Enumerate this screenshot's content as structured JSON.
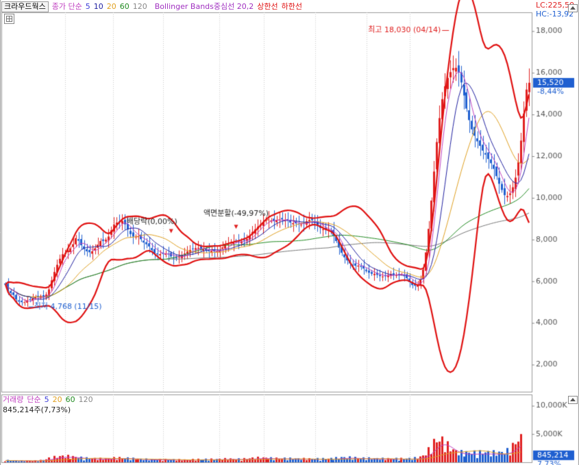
{
  "header": {
    "stock_name": "크라우드웍스",
    "ma_label": "종가 단순",
    "ma_periods": [
      {
        "text": "5",
        "color": "#3a3ad8"
      },
      {
        "text": "10",
        "color": "#1f1fa0"
      },
      {
        "text": "20",
        "color": "#e0a020"
      },
      {
        "text": "60",
        "color": "#1f8a1f"
      },
      {
        "text": "120",
        "color": "#888888"
      }
    ],
    "bb_label": "Bollinger Bands중심선 20,2",
    "bb_upper": "상한선",
    "bb_lower": "하한선",
    "lc": "LC:225,50",
    "hc": "HC:-13,92"
  },
  "volume_header": {
    "label": "거래량",
    "ma_label": "단순",
    "ma_periods": [
      {
        "text": "5",
        "color": "#3a3ad8"
      },
      {
        "text": "20",
        "color": "#e0a020"
      },
      {
        "text": "60",
        "color": "#1f8a1f"
      },
      {
        "text": "120",
        "color": "#888888"
      }
    ],
    "current": "845,214주(7,73%)"
  },
  "colors": {
    "up": "#e02020",
    "down": "#1f5fd0",
    "bb": "#e01010",
    "ma5": "#c040c0",
    "ma10": "#1f1fa0",
    "ma20": "#e0a020",
    "ma60": "#1f8a1f",
    "ma120": "#777777",
    "axis": "#888888"
  },
  "chart_data": {
    "type": "candlestick",
    "price_axis": {
      "ticks": [
        2000,
        4000,
        6000,
        8000,
        10000,
        12000,
        14000,
        16000,
        18000
      ],
      "tick_labels": [
        "2,000",
        "4,000",
        "6,000",
        "8,000",
        "10,000",
        "12,000",
        "14,000",
        "16,000",
        "18,000"
      ],
      "ylim": [
        700,
        18900
      ]
    },
    "volume_axis": {
      "ticks": [
        5000,
        10000
      ],
      "tick_labels": [
        "5,000K",
        "10,000K"
      ],
      "ylim": [
        0,
        12000
      ]
    },
    "last_price": "15,520",
    "last_change": "-8,44%",
    "last_volume": "845,214",
    "last_volume_pct": "7,73%",
    "annotations": {
      "high": {
        "text": "최고 18,030 (04/14)",
        "index": 164,
        "value": 18030
      },
      "low": {
        "text": "최저 4,768 (11/15)",
        "index": 8,
        "value": 4768
      },
      "dividend": {
        "text": "배당락(0,00%)",
        "index": 54,
        "value": 8900
      },
      "split": {
        "text": "액면분할(-49,97%)",
        "index": 85,
        "value": 9100
      }
    },
    "close": [
      5836,
      5590,
      5434,
      5339,
      5130,
      5023,
      4997,
      4994,
      5089,
      5114,
      5173,
      5267,
      5245,
      5294,
      5212,
      5358,
      5607,
      6042,
      6444,
      6789,
      7077,
      7295,
      7359,
      7468,
      7579,
      7777,
      8073,
      7945,
      7726,
      7548,
      7437,
      7392,
      7441,
      7580,
      7756,
      7931,
      7934,
      7995,
      8142,
      8444,
      8714,
      8813,
      8852,
      8892,
      8732,
      8486,
      8262,
      8142,
      8149,
      8158,
      8015,
      7857,
      7775,
      7669,
      7491,
      7338,
      7292,
      7301,
      7316,
      7338,
      7294,
      7193,
      7111,
      7111,
      7174,
      7236,
      7331,
      7426,
      7498,
      7566,
      7586,
      7602,
      7544,
      7537,
      7475,
      7441,
      7457,
      7427,
      7426,
      7480,
      7622,
      7736,
      7792,
      7867,
      7894,
      7898,
      7887,
      7915,
      7981,
      8022,
      8170,
      8363,
      8483,
      8618,
      8732,
      8842,
      8937,
      8965,
      8913,
      8885,
      8940,
      8960,
      8972,
      8936,
      8903,
      8816,
      8788,
      8775,
      8746,
      8717,
      8778,
      8874,
      8936,
      8932,
      8829,
      8660,
      8558,
      8491,
      8465,
      8468,
      8382,
      8191,
      7926,
      7612,
      7362,
      7148,
      7000,
      6856,
      6790,
      6743,
      6749,
      6689,
      6609,
      6492,
      6408,
      6357,
      6353,
      6307,
      6245,
      6226,
      6240,
      6296,
      6330,
      6326,
      6317,
      6314,
      6336,
      6277,
      6146,
      5960,
      5816,
      5782,
      5820,
      6083,
      6560,
      7384,
      8514,
      9872,
      11262,
      12677,
      13825,
      14734,
      15355,
      15750,
      16032,
      16222,
      16236,
      16011,
      15536,
      14912,
      14282,
      13730,
      13286,
      12977,
      12710,
      12494,
      12266,
      12078,
      11864,
      11663,
      11390,
      11042,
      10676,
      10380,
      10132,
      10085,
      10212,
      10508,
      10970,
      11713,
      12746,
      14044,
      15195,
      15520
    ],
    "volume": [
      310,
      290,
      280,
      270,
      260,
      250,
      240,
      230,
      230,
      230,
      230,
      240,
      260,
      300,
      360,
      470,
      600,
      700,
      760,
      820,
      870,
      900,
      900,
      880,
      840,
      800,
      780,
      720,
      680,
      640,
      610,
      580,
      560,
      550,
      540,
      530,
      530,
      540,
      560,
      590,
      620,
      650,
      660,
      660,
      640,
      610,
      580,
      550,
      520,
      500,
      480,
      460,
      450,
      440,
      430,
      420,
      420,
      420,
      420,
      420,
      420,
      410,
      400,
      390,
      380,
      380,
      380,
      380,
      390,
      400,
      420,
      440,
      450,
      450,
      450,
      450,
      450,
      450,
      460,
      470,
      490,
      500,
      500,
      500,
      490,
      480,
      480,
      490,
      510,
      540,
      580,
      620,
      650,
      660,
      660,
      650,
      640,
      620,
      600,
      590,
      580,
      580,
      580,
      580,
      570,
      560,
      550,
      540,
      530,
      520,
      520,
      520,
      520,
      520,
      520,
      520,
      520,
      520,
      530,
      540,
      560,
      590,
      620,
      660,
      700,
      720,
      720,
      710,
      690,
      670,
      650,
      630,
      610,
      600,
      590,
      580,
      570,
      560,
      550,
      540,
      540,
      540,
      540,
      540,
      540,
      540,
      540,
      540,
      550,
      560,
      580,
      620,
      680,
      780,
      960,
      1300,
      1800,
      2400,
      2900,
      3200,
      3300,
      3200,
      2900,
      2500,
      2100,
      1800,
      1600,
      1500,
      1450,
      1430,
      1420,
      1420,
      1430,
      1440,
      1450,
      1460,
      1460,
      1460,
      1450,
      1440,
      1430,
      1420,
      1420,
      1450,
      1530,
      1700,
      2000,
      2400,
      2900,
      3300,
      3500
    ]
  }
}
